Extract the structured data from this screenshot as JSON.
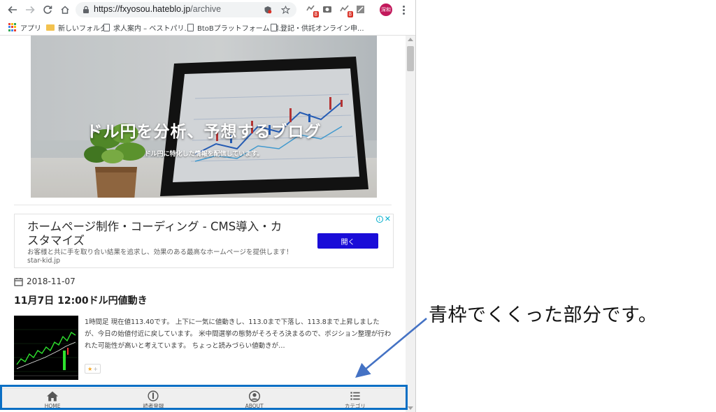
{
  "browser": {
    "url_host": "https://fxyosou.hateblo.jp",
    "url_path": "/archive",
    "extension_badges": [
      "8",
      "8"
    ],
    "profile_initials": "深和",
    "bookmarks": [
      {
        "label": "アプリ",
        "icon": "apps-grid-icon"
      },
      {
        "label": "新しいフォルダ",
        "icon": "folder-icon"
      },
      {
        "label": "求人案内 – ベストパリ...",
        "icon": "page-icon"
      },
      {
        "label": "BtoBプラットフォーム 請...",
        "icon": "page-icon"
      },
      {
        "label": "登記・供託オンライン申...",
        "icon": "page-icon"
      }
    ]
  },
  "hero": {
    "title": "ドル円を分析、予想するブログ",
    "subtitle": "ドル円に特化した情報を配信しています。"
  },
  "ad": {
    "title": "ホームページ制作・コーディング - CMS導入・カスタマイズ",
    "description": "お客様と共に手を取り合い結果を追求し、効果のある最高なホームページを提供します！ star-kid.jp",
    "button_label": "開く"
  },
  "post": {
    "date": "2018-11-07",
    "title": "11月7日 12:00ドル円値動き",
    "excerpt": "1時間足 現在値113.40です。 上下に一気に値動きし、113.0まで下落し、113.8まで上昇しましたが、今日の始値付近に戻しています。 米中間選挙の態勢がそろそろ決まるので、ポジション整理が行われた可能性が高いと考えています。 ちょっと読みづらい値動きが…",
    "star_symbol": "★",
    "star_plus": "+"
  },
  "bottom_nav": [
    {
      "label": "HOME",
      "icon": "home-icon"
    },
    {
      "label": "読者登録",
      "icon": "subscribe-icon"
    },
    {
      "label": "ABOUT",
      "icon": "about-user-icon"
    },
    {
      "label": "カテゴリ",
      "icon": "category-list-icon"
    }
  ],
  "annotation": {
    "text": "青枠でくくった部分です。"
  },
  "colors": {
    "highlight_border": "#0b6fc4",
    "arrow": "#4472c4",
    "ad_button": "#1a0dd8",
    "adchoices": "#00aecd"
  }
}
